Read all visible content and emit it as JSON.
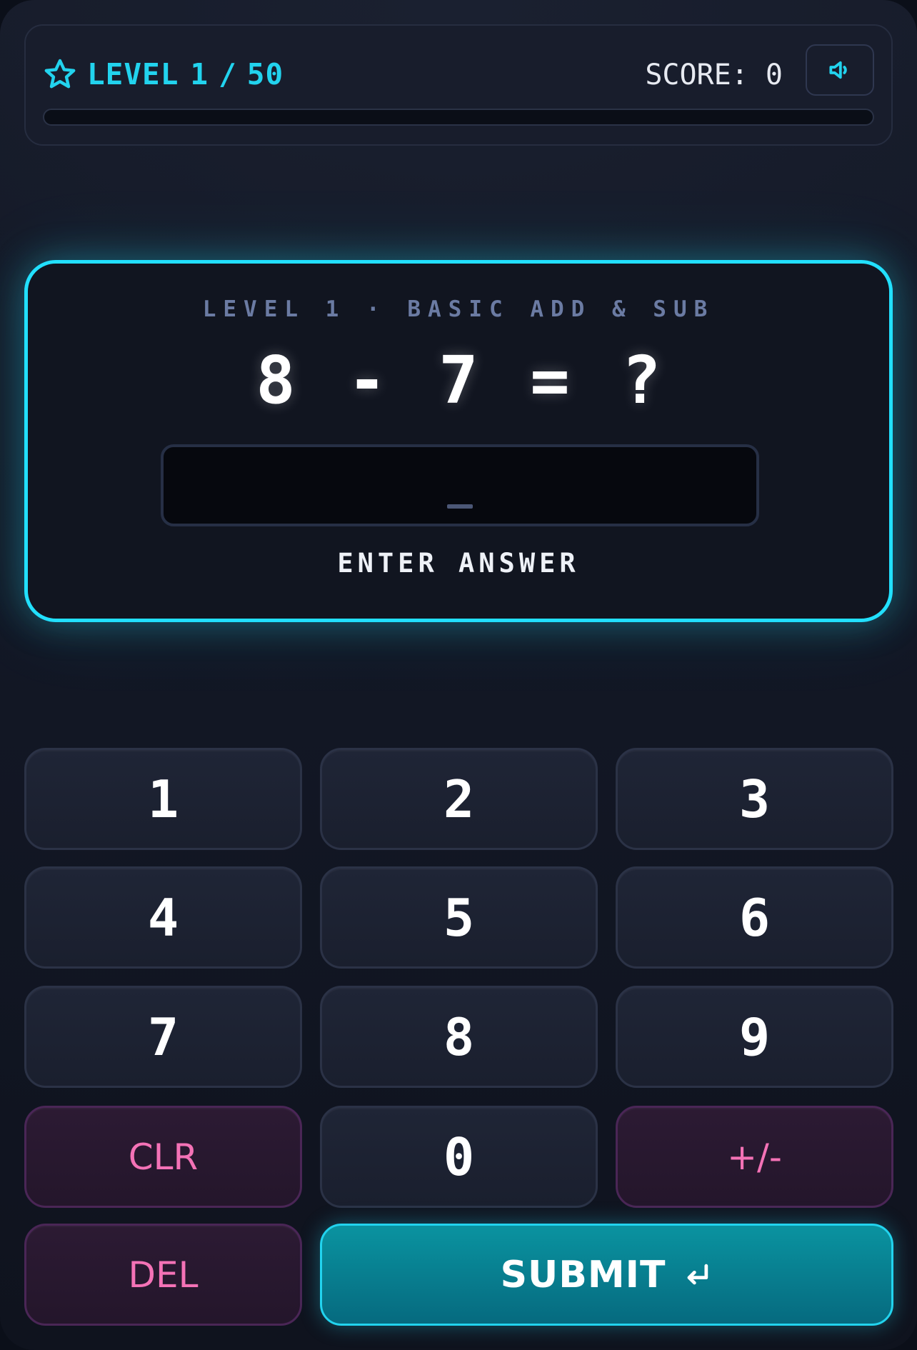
{
  "hud": {
    "level_label": "LEVEL",
    "current_level": "1",
    "separator": "/",
    "total_levels": "50",
    "score_label": "SCORE:",
    "score_value": "0",
    "progress_fraction": 0.0,
    "accent_color": "#22d3ee",
    "icons": {
      "level": "star-icon",
      "sound": "speaker-icon"
    }
  },
  "question": {
    "subtitle": "LEVEL 1 · BASIC ADD & SUB",
    "equation": {
      "left_operand": "8",
      "operator": "-",
      "right_operand": "7",
      "equals": "=",
      "unknown": "?"
    },
    "answer_value": "",
    "answer_prompt": "ENTER ANSWER"
  },
  "keypad": {
    "digits": [
      "1",
      "2",
      "3",
      "4",
      "5",
      "6",
      "7",
      "8",
      "9",
      "0"
    ],
    "clear_label": "CLR",
    "sign_label": "+/-",
    "delete_label": "DEL",
    "submit_label": "SUBMIT",
    "submit_icon": "enter-return-icon",
    "colors": {
      "digit_text": "#ffffff",
      "action_text": "#f472b6",
      "submit_bg": "#0a93a0",
      "submit_border": "#22d3ee"
    }
  }
}
